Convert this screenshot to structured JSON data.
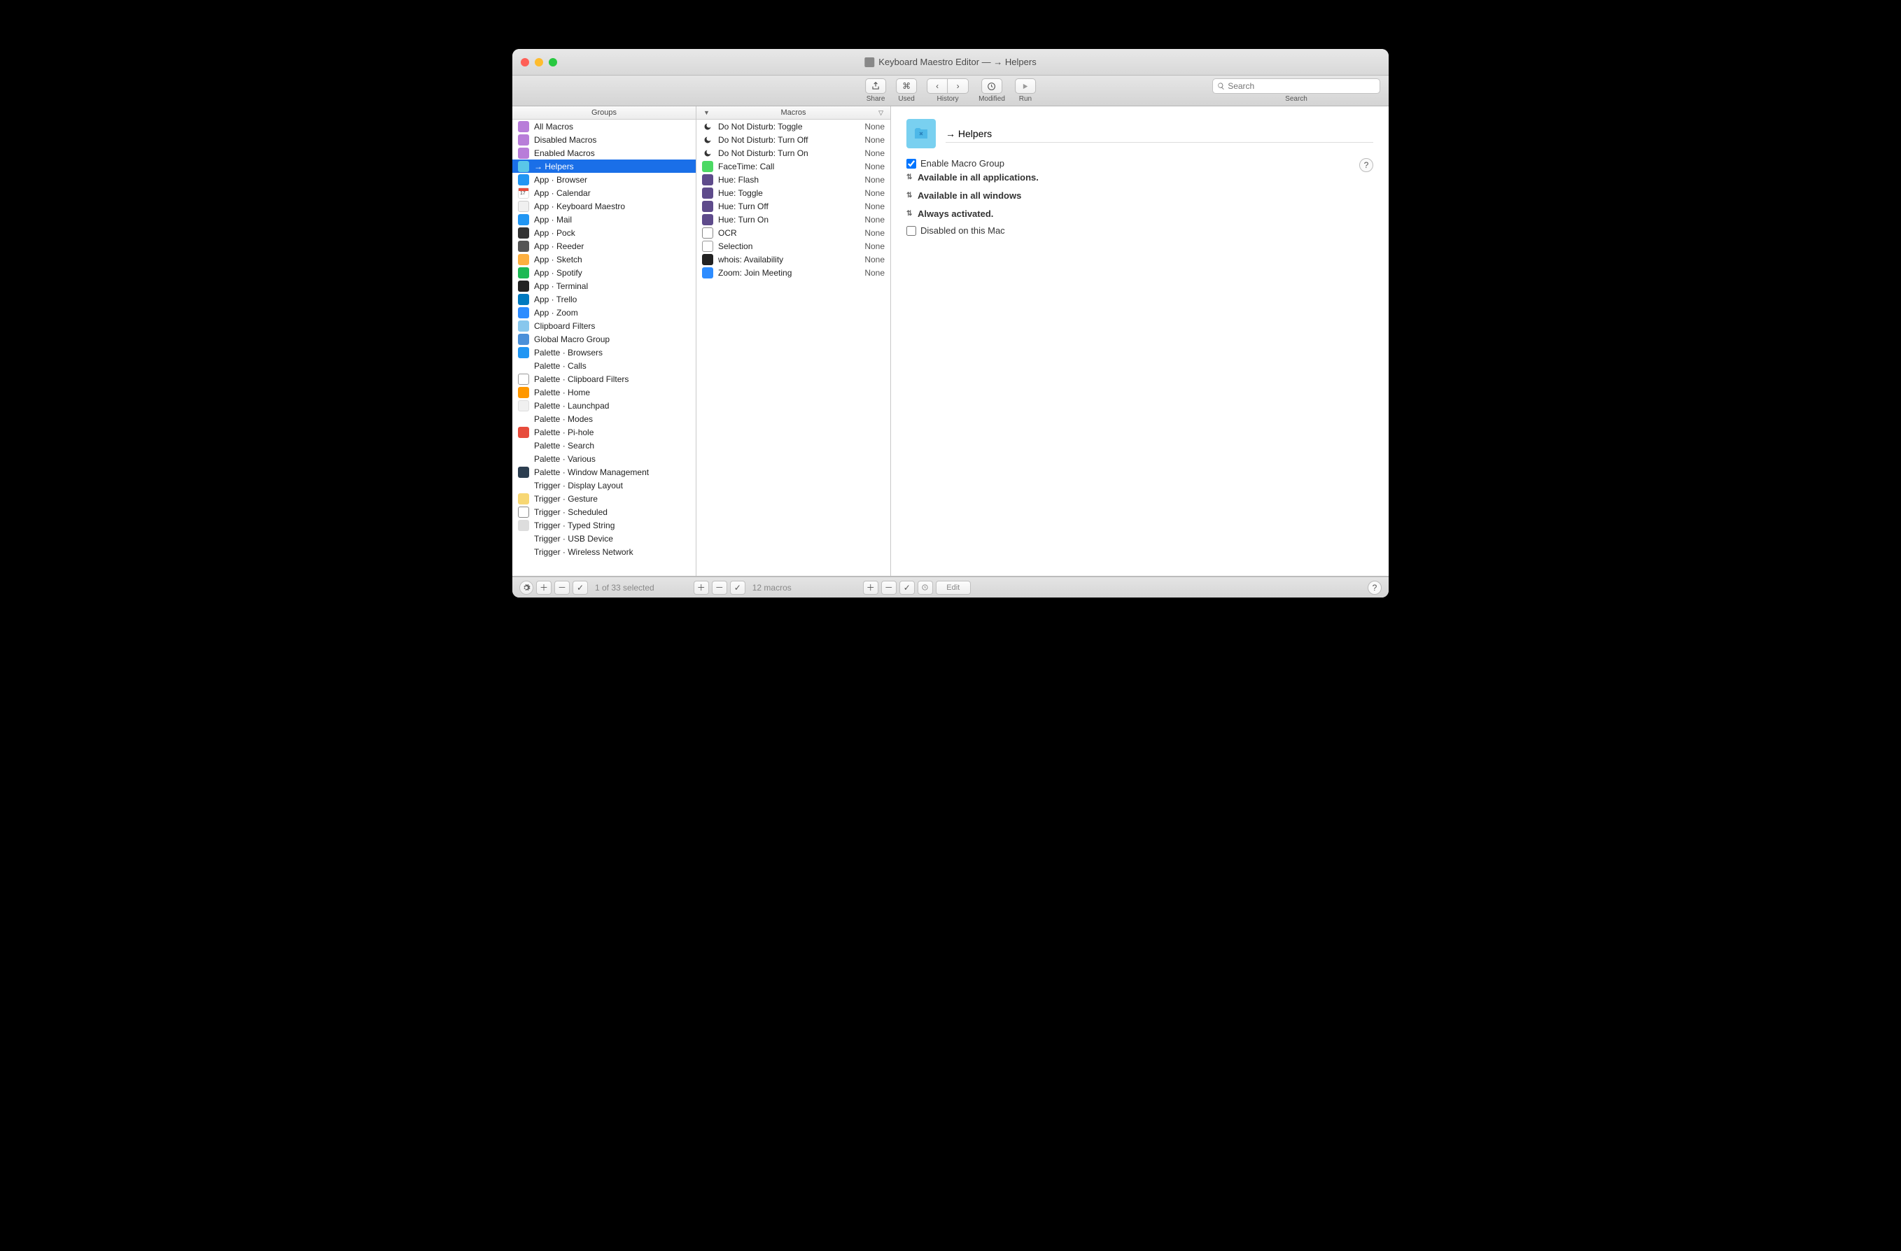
{
  "window_title": "Keyboard Maestro Editor — → Helpers",
  "toolbar": {
    "share": "Share",
    "used": "Used",
    "history": "History",
    "modified": "Modified",
    "run": "Run",
    "search_label": "Search",
    "search_placeholder": "Search"
  },
  "columns": {
    "groups_header": "Groups",
    "macros_header": "Macros"
  },
  "groups": [
    {
      "label": "All Macros",
      "icon": "i-folder-purple"
    },
    {
      "label": "Disabled Macros",
      "icon": "i-folder-purple"
    },
    {
      "label": "Enabled Macros",
      "icon": "i-folder-purple"
    },
    {
      "label": "→ Helpers",
      "icon": "i-folder-cyan",
      "selected": true
    },
    {
      "label": "App · Browser",
      "icon": "i-safari"
    },
    {
      "label": "App · Calendar",
      "icon": "i-cal"
    },
    {
      "label": "App · Keyboard Maestro",
      "icon": "i-km"
    },
    {
      "label": "App · Mail",
      "icon": "i-mail"
    },
    {
      "label": "App · Pock",
      "icon": "i-pock"
    },
    {
      "label": "App · Reeder",
      "icon": "i-reeder"
    },
    {
      "label": "App · Sketch",
      "icon": "i-sketch"
    },
    {
      "label": "App · Spotify",
      "icon": "i-spotify"
    },
    {
      "label": "App · Terminal",
      "icon": "i-terminal"
    },
    {
      "label": "App · Trello",
      "icon": "i-trello"
    },
    {
      "label": "App · Zoom",
      "icon": "i-zoom"
    },
    {
      "label": "Clipboard Filters",
      "icon": "i-folder-lblue"
    },
    {
      "label": "Global Macro Group",
      "icon": "i-globe"
    },
    {
      "label": "Palette · Browsers",
      "icon": "i-safari"
    },
    {
      "label": "Palette · Calls",
      "icon": "i-phone"
    },
    {
      "label": "Palette · Clipboard Filters",
      "icon": "i-clip"
    },
    {
      "label": "Palette · Home",
      "icon": "i-home"
    },
    {
      "label": "Palette · Launchpad",
      "icon": "i-launch"
    },
    {
      "label": "Palette · Modes",
      "icon": "i-modes"
    },
    {
      "label": "Palette · Pi-hole",
      "icon": "i-pihole"
    },
    {
      "label": "Palette · Search",
      "icon": "i-search"
    },
    {
      "label": "Palette · Various",
      "icon": "i-dots"
    },
    {
      "label": "Palette · Window Management",
      "icon": "i-monitor"
    },
    {
      "label": "Trigger · Display Layout",
      "icon": "i-display"
    },
    {
      "label": "Trigger · Gesture",
      "icon": "i-gesture"
    },
    {
      "label": "Trigger · Scheduled",
      "icon": "i-clock"
    },
    {
      "label": "Trigger · Typed String",
      "icon": "i-typed"
    },
    {
      "label": "Trigger · USB Device",
      "icon": "i-usb"
    },
    {
      "label": "Trigger · Wireless Network",
      "icon": "i-wifi"
    }
  ],
  "macros": [
    {
      "label": "Do Not Disturb: Toggle",
      "icon": "i-moon",
      "trigger": "None"
    },
    {
      "label": "Do Not Disturb: Turn Off",
      "icon": "i-moon",
      "trigger": "None"
    },
    {
      "label": "Do Not Disturb: Turn On",
      "icon": "i-moon",
      "trigger": "None"
    },
    {
      "label": "FaceTime: Call",
      "icon": "i-facetime",
      "trigger": "None"
    },
    {
      "label": "Hue: Flash",
      "icon": "i-hue",
      "trigger": "None"
    },
    {
      "label": "Hue: Toggle",
      "icon": "i-hue",
      "trigger": "None"
    },
    {
      "label": "Hue: Turn Off",
      "icon": "i-hue",
      "trigger": "None"
    },
    {
      "label": "Hue: Turn On",
      "icon": "i-hue",
      "trigger": "None"
    },
    {
      "label": "OCR",
      "icon": "i-ocr",
      "trigger": "None"
    },
    {
      "label": "Selection",
      "icon": "i-sel",
      "trigger": "None"
    },
    {
      "label": "whois: Availability",
      "icon": "i-whois",
      "trigger": "None"
    },
    {
      "label": "Zoom: Join Meeting",
      "icon": "i-zoom",
      "trigger": "None"
    }
  ],
  "detail": {
    "title": "→ Helpers",
    "enable_label": "Enable Macro Group",
    "enable_checked": true,
    "apps": "Available in all applications.",
    "windows": "Available in all windows",
    "activated": "Always activated.",
    "disabled_mac": "Disabled on this Mac",
    "disabled_checked": false
  },
  "footer": {
    "groups_status": "1 of 33 selected",
    "macros_status": "12 macros",
    "edit_label": "Edit"
  }
}
